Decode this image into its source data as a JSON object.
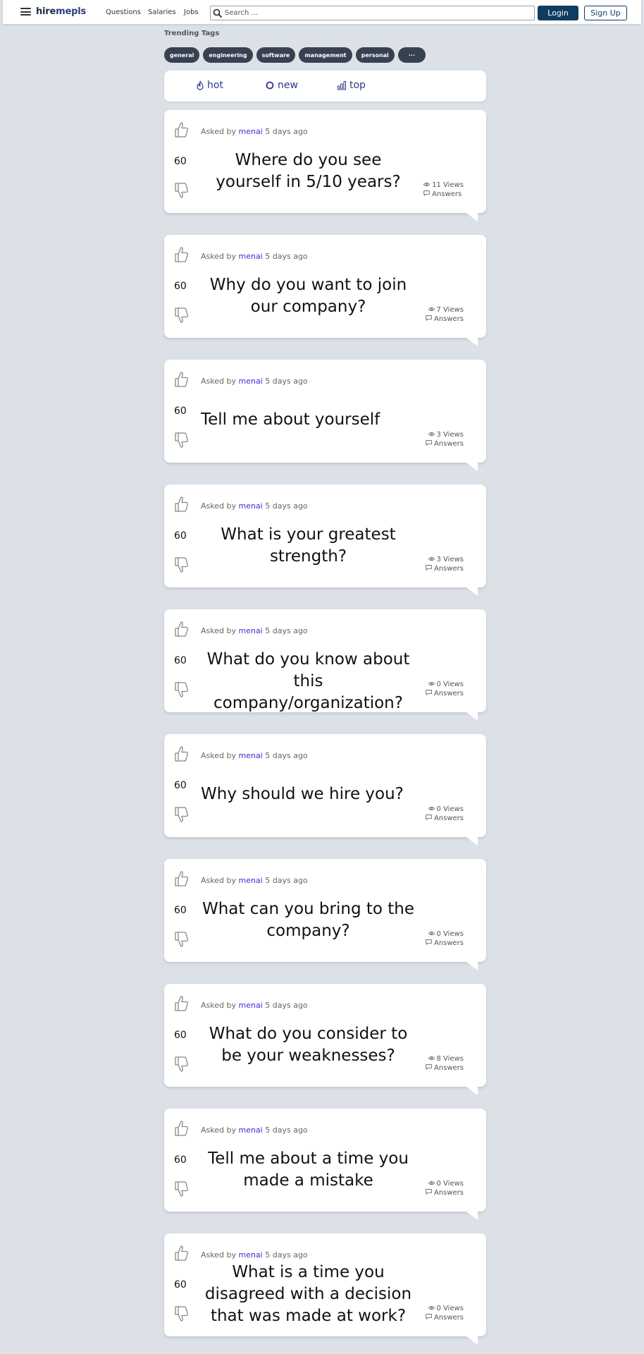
{
  "navbar": {
    "brand_part1": "hire",
    "brand_part2": "mepls",
    "links": [
      "Questions",
      "Salaries",
      "Jobs"
    ],
    "search_placeholder": "Search ...",
    "login_label": "Login",
    "signup_label": "Sign Up"
  },
  "trending": {
    "title": "Trending Tags",
    "tags": [
      "general",
      "engineering",
      "software",
      "management",
      "personal"
    ],
    "more_label": "···"
  },
  "sort": {
    "hot": "hot",
    "new": "new",
    "top": "top"
  },
  "asked_prefix": "Asked by",
  "questions": [
    {
      "score": "60",
      "author": "menai",
      "age": "5 days ago",
      "title": "Where do you see yourself in 5/10 years?",
      "views": "11 Views",
      "answers": "Answers"
    },
    {
      "score": "60",
      "author": "menai",
      "age": "5 days ago",
      "title": "Why do you want to join our company?",
      "views": "7 Views",
      "answers": "Answers"
    },
    {
      "score": "60",
      "author": "menai",
      "age": "5 days ago",
      "title": "Tell me about yourself",
      "views": "3 Views",
      "answers": "Answers"
    },
    {
      "score": "60",
      "author": "menai",
      "age": "5 days ago",
      "title": "What is your greatest strength?",
      "views": "3 Views",
      "answers": "Answers"
    },
    {
      "score": "60",
      "author": "menai",
      "age": "5 days ago",
      "title": "What do you know about this company/organization?",
      "views": "0 Views",
      "answers": "Answers"
    },
    {
      "score": "60",
      "author": "menai",
      "age": "5 days ago",
      "title": "Why should we hire you?",
      "views": "0 Views",
      "answers": "Answers"
    },
    {
      "score": "60",
      "author": "menai",
      "age": "5 days ago",
      "title": "What can you bring to the company?",
      "views": "0 Views",
      "answers": "Answers"
    },
    {
      "score": "60",
      "author": "menai",
      "age": "5 days ago",
      "title": "What do you consider to be your weaknesses?",
      "views": "8 Views",
      "answers": "Answers"
    },
    {
      "score": "60",
      "author": "menai",
      "age": "5 days ago",
      "title": "Tell me about a time you made a mistake",
      "views": "0 Views",
      "answers": "Answers"
    },
    {
      "score": "60",
      "author": "menai",
      "age": "5 days ago",
      "title": "What is a time you disagreed with a decision that was made at work?",
      "views": "0 Views",
      "answers": "Answers"
    }
  ],
  "colors": {
    "background": "#dce1e8",
    "primary": "#0f3c61",
    "tag": "#374151",
    "author_link": "#3a2fd4",
    "sort_accent": "#2e3a8c"
  }
}
